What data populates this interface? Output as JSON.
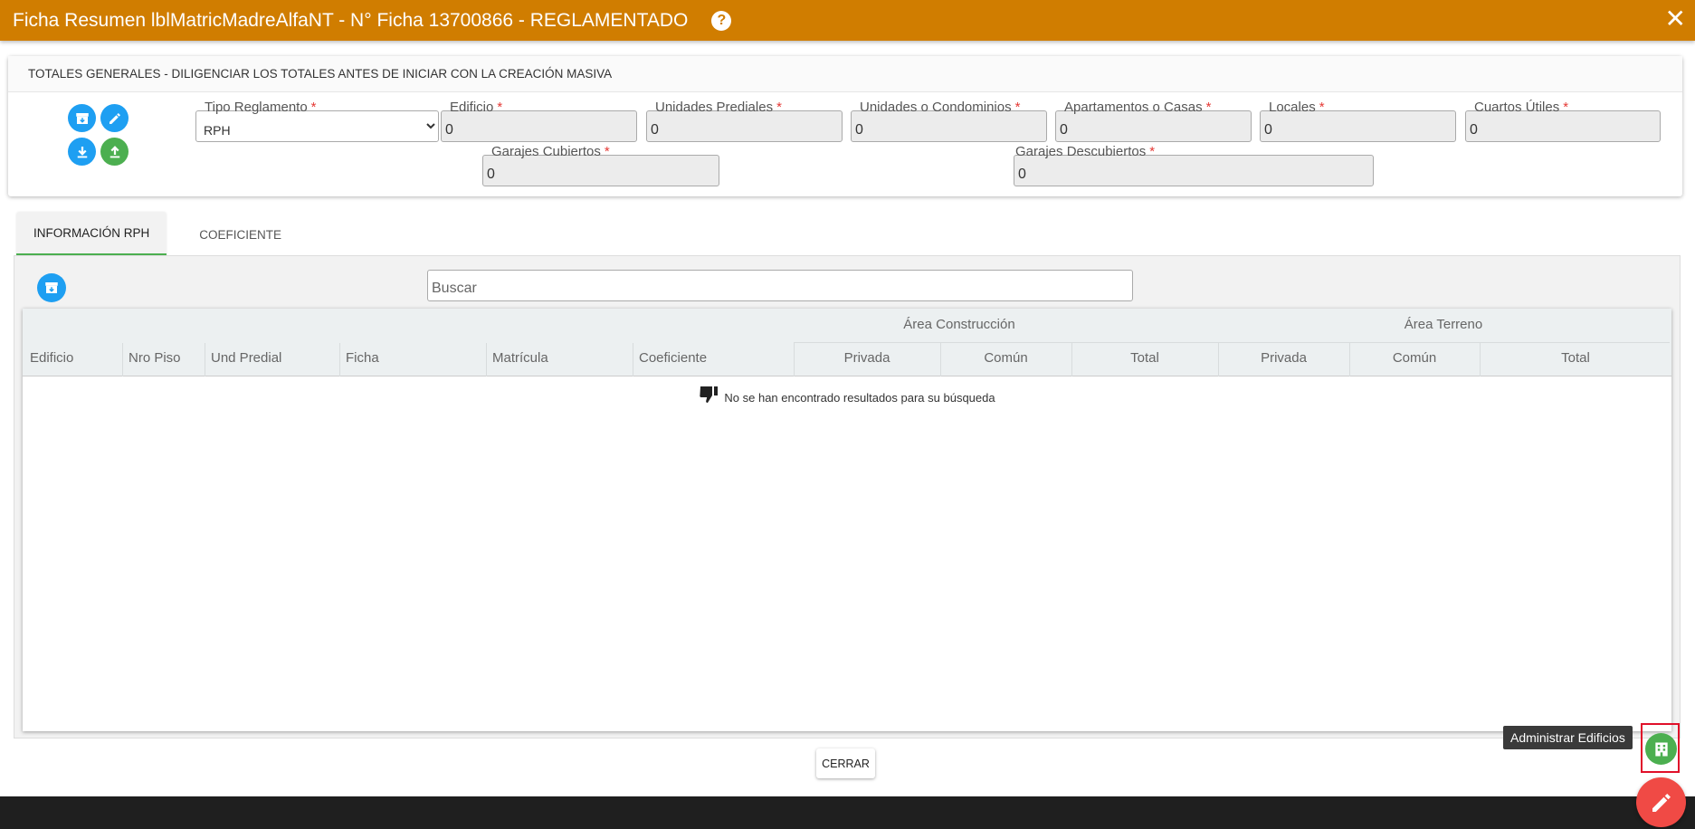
{
  "window": {
    "title": "Ficha Resumen lblMatricMadreAlfaNT - N° Ficha 13700866 - REGLAMENTADO",
    "help_icon": "?",
    "close_icon": "✕"
  },
  "totals": {
    "heading": "TOTALES GENERALES - DILIGENCIAR LOS TOTALES ANTES DE INICIAR CON LA CREACIÓN MASIVA",
    "required_mark": "*",
    "fields": {
      "tipo_reglamento": {
        "label": "Tipo Reglamento",
        "value": "RPH",
        "options": [
          "RPH"
        ]
      },
      "edificio": {
        "label": "Edificio",
        "value": "0"
      },
      "unidades_prediales": {
        "label": "Unidades Prediales",
        "value": "0"
      },
      "unidades_condominios": {
        "label": "Unidades o Condominios",
        "value": "0"
      },
      "apartamentos_casas": {
        "label": "Apartamentos o Casas",
        "value": "0"
      },
      "locales": {
        "label": "Locales",
        "value": "0"
      },
      "cuartos_utiles": {
        "label": "Cuartos Útiles",
        "value": "0"
      },
      "garajes_cubiertos": {
        "label": "Garajes Cubiertos",
        "value": "0"
      },
      "garajes_descubiertos": {
        "label": "Garajes Descubiertos",
        "value": "0"
      }
    }
  },
  "tabs": [
    {
      "label": "INFORMACIÓN RPH",
      "active": true
    },
    {
      "label": "COEFICIENTE",
      "active": false
    }
  ],
  "search": {
    "placeholder": "Buscar",
    "value": ""
  },
  "table": {
    "groups": {
      "area_construccion": "Área Construcción",
      "area_terreno": "Área Terreno"
    },
    "columns": {
      "edificio": "Edificio",
      "nro_piso": "Nro Piso",
      "und_predial": "Und Predial",
      "ficha": "Ficha",
      "matricula": "Matrícula",
      "coeficiente": "Coeficiente",
      "const_privada": "Privada",
      "const_comun": "Común",
      "const_total": "Total",
      "terr_privada": "Privada",
      "terr_comun": "Común",
      "terr_total": "Total"
    },
    "empty_message": "No se han encontrado resultados para su búsqueda"
  },
  "buttons": {
    "cerrar": "CERRAR"
  },
  "fab": {
    "tooltip": "Administrar Edificios"
  },
  "colors": {
    "header": "#d07d00",
    "primary_blue": "#1e9ff2",
    "success_green": "#4caf50",
    "fab_red": "#f04a45",
    "highlight_red": "#e0102a"
  }
}
